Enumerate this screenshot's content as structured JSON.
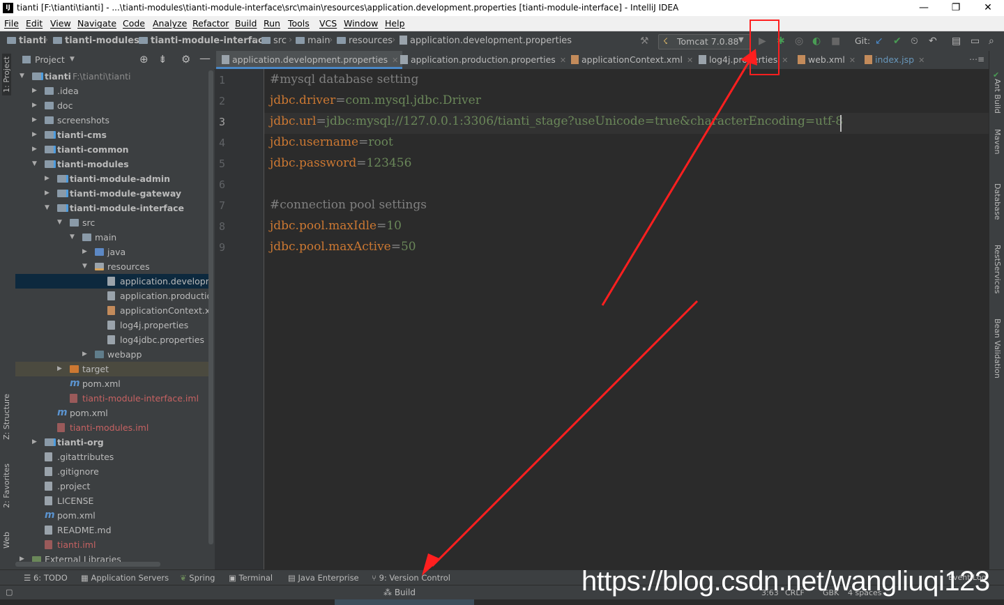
{
  "window": {
    "title": "tianti [F:\\tianti\\tianti] - ...\\tianti-modules\\tianti-module-interface\\src\\main\\resources\\application.development.properties [tianti-module-interface] - IntelliJ IDEA",
    "app_icon": "IJ",
    "minimize": "—",
    "restore": "❐",
    "close": "✕"
  },
  "menu": [
    "File",
    "Edit",
    "View",
    "Navigate",
    "Code",
    "Analyze",
    "Refactor",
    "Build",
    "Run",
    "Tools",
    "VCS",
    "Window",
    "Help"
  ],
  "breadcrumb": [
    "tianti",
    "tianti-modules",
    "tianti-module-interface",
    "src",
    "main",
    "resources",
    "application.development.properties"
  ],
  "toolbar": {
    "run_config": "Tomcat 7.0.88",
    "git_label": "Git:",
    "icons": [
      "hammer-icon",
      "run-icon",
      "debug-icon",
      "coverage-icon",
      "profile-icon",
      "stop-icon",
      "git-update-icon",
      "git-commit-icon",
      "history-icon",
      "revert-icon",
      "project-structure-icon",
      "presentation-icon",
      "search-icon"
    ]
  },
  "project_panel": {
    "title": "Project",
    "tree": [
      {
        "label": "tianti",
        "path": "F:\\tianti\\tianti",
        "level": 0,
        "arrow": "open",
        "icon": "module",
        "bold": true
      },
      {
        "label": ".idea",
        "level": 1,
        "arrow": "closed",
        "icon": "folder"
      },
      {
        "label": "doc",
        "level": 1,
        "arrow": "closed",
        "icon": "folder"
      },
      {
        "label": "screenshots",
        "level": 1,
        "arrow": "closed",
        "icon": "folder"
      },
      {
        "label": "tianti-cms",
        "level": 1,
        "arrow": "closed",
        "icon": "module",
        "bold": true
      },
      {
        "label": "tianti-common",
        "level": 1,
        "arrow": "closed",
        "icon": "module",
        "bold": true
      },
      {
        "label": "tianti-modules",
        "level": 1,
        "arrow": "open",
        "icon": "module",
        "bold": true
      },
      {
        "label": "tianti-module-admin",
        "level": 2,
        "arrow": "closed",
        "icon": "module",
        "bold": true
      },
      {
        "label": "tianti-module-gateway",
        "level": 2,
        "arrow": "closed",
        "icon": "module",
        "bold": true
      },
      {
        "label": "tianti-module-interface",
        "level": 2,
        "arrow": "open",
        "icon": "module",
        "bold": true
      },
      {
        "label": "src",
        "level": 3,
        "arrow": "open",
        "icon": "folder"
      },
      {
        "label": "main",
        "level": 4,
        "arrow": "open",
        "icon": "folder"
      },
      {
        "label": "java",
        "level": 5,
        "arrow": "closed",
        "icon": "src"
      },
      {
        "label": "resources",
        "level": 5,
        "arrow": "open",
        "icon": "res"
      },
      {
        "label": "application.developmen",
        "level": 6,
        "arrow": "none",
        "icon": "file",
        "state": "selected"
      },
      {
        "label": "application.production.p",
        "level": 6,
        "arrow": "none",
        "icon": "file"
      },
      {
        "label": "applicationContext.xml",
        "level": 6,
        "arrow": "none",
        "icon": "xml"
      },
      {
        "label": "log4j.properties",
        "level": 6,
        "arrow": "none",
        "icon": "file"
      },
      {
        "label": "log4jdbc.properties",
        "level": 6,
        "arrow": "none",
        "icon": "file"
      },
      {
        "label": "webapp",
        "level": 5,
        "arrow": "closed",
        "icon": "web"
      },
      {
        "label": "target",
        "level": 3,
        "arrow": "closed",
        "icon": "target",
        "state": "dim"
      },
      {
        "label": "pom.xml",
        "level": 3,
        "arrow": "none",
        "icon": "maven"
      },
      {
        "label": "tianti-module-interface.iml",
        "level": 3,
        "arrow": "none",
        "icon": "iml",
        "red": true
      },
      {
        "label": "pom.xml",
        "level": 2,
        "arrow": "none",
        "icon": "maven"
      },
      {
        "label": "tianti-modules.iml",
        "level": 2,
        "arrow": "none",
        "icon": "iml",
        "red": true
      },
      {
        "label": "tianti-org",
        "level": 1,
        "arrow": "closed",
        "icon": "module",
        "bold": true
      },
      {
        "label": ".gitattributes",
        "level": 1,
        "arrow": "none",
        "icon": "file"
      },
      {
        "label": ".gitignore",
        "level": 1,
        "arrow": "none",
        "icon": "file"
      },
      {
        "label": ".project",
        "level": 1,
        "arrow": "none",
        "icon": "file"
      },
      {
        "label": "LICENSE",
        "level": 1,
        "arrow": "none",
        "icon": "file"
      },
      {
        "label": "pom.xml",
        "level": 1,
        "arrow": "none",
        "icon": "maven"
      },
      {
        "label": "README.md",
        "level": 1,
        "arrow": "none",
        "icon": "file"
      },
      {
        "label": "tianti.iml",
        "level": 1,
        "arrow": "none",
        "icon": "iml",
        "red": true
      },
      {
        "label": "External Libraries",
        "level": 0,
        "arrow": "closed",
        "icon": "lib"
      }
    ]
  },
  "tabs": [
    {
      "label": "application.development.properties",
      "active": true
    },
    {
      "label": "application.production.properties"
    },
    {
      "label": "applicationContext.xml"
    },
    {
      "label": "log4j.properties"
    },
    {
      "label": "web.xml"
    },
    {
      "label": "index.jsp",
      "color": "#6897bb"
    }
  ],
  "editor": {
    "current_line": 3,
    "lines": [
      [
        {
          "t": "#mysql database setting",
          "c": "c"
        }
      ],
      [
        {
          "t": "jdbc.driver",
          "c": "k"
        },
        {
          "t": "=",
          "c": "c"
        },
        {
          "t": "com.mysql.jdbc.Driver",
          "c": "v"
        }
      ],
      [
        {
          "t": "jdbc.url",
          "c": "k"
        },
        {
          "t": "=",
          "c": "c"
        },
        {
          "t": "jdbc:mysql://127.0.0.1:3306/tianti_stage?useUnicode=true&characterEncoding=utf-8",
          "c": "v"
        }
      ],
      [
        {
          "t": "jdbc.username",
          "c": "k"
        },
        {
          "t": "=",
          "c": "c"
        },
        {
          "t": "root",
          "c": "v"
        }
      ],
      [
        {
          "t": "jdbc.password",
          "c": "k"
        },
        {
          "t": "=",
          "c": "c"
        },
        {
          "t": "123456",
          "c": "v"
        }
      ],
      [],
      [
        {
          "t": "#connection pool settings",
          "c": "c"
        }
      ],
      [
        {
          "t": "jdbc.pool.maxIdle",
          "c": "k"
        },
        {
          "t": "=",
          "c": "c"
        },
        {
          "t": "10",
          "c": "v"
        }
      ],
      [
        {
          "t": "jdbc.pool.maxActive",
          "c": "k"
        },
        {
          "t": "=",
          "c": "c"
        },
        {
          "t": "50",
          "c": "v"
        }
      ]
    ]
  },
  "left_stripe": [
    "1: Project",
    "Z: Structure",
    "2: Favorites",
    "Web"
  ],
  "right_stripe": [
    "Ant Build",
    "Maven",
    "Database",
    "RestServices",
    "Bean Validation"
  ],
  "bottom_tools": [
    "6: TODO",
    "Application Servers",
    "Spring",
    "Terminal",
    "Java Enterprise",
    "9: Version Control"
  ],
  "status": {
    "build": "Build",
    "position": "3:63",
    "line_sep": "CRLF",
    "encoding": "GBK",
    "indent": "4 spaces",
    "event_log": "Event Log"
  },
  "watermark": "https://blog.csdn.net/wangliuqi123",
  "annotation_color": "#ff1f1f"
}
